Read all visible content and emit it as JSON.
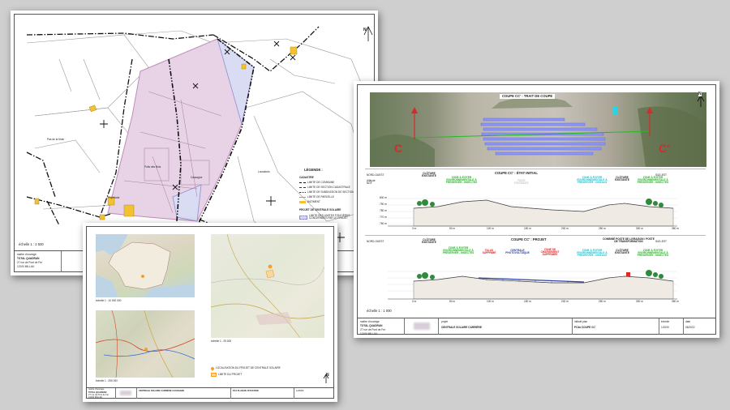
{
  "colors": {
    "background": "#cfcfcf",
    "parcel_fill": "#e8d3e6",
    "parcel_stroke": "#c28bbb",
    "project_fill": "#d9dcf3",
    "solar_yellow": "#f2c232",
    "vegetation_green": "#2f8a3b",
    "arrow_red": "#d8292b",
    "label_green": "#1fb31f",
    "label_cyan": "#17c1cf",
    "label_red": "#e01f1f",
    "label_blue": "#2a3fa8",
    "panel_blue": "#8f98f0"
  },
  "cadastral_sheet": {
    "north_letter": "N",
    "legend": {
      "title": "LÉGENDE :",
      "cadastre_heading": "CADASTRE",
      "items": [
        "LIMITE DE COMMUNE",
        "LIMITE DE SECTION CADASTRALE",
        "LIMITE DE SUBDIVISION DE SECTION",
        "LIMITE DE PARCELLE",
        "BATIMENT"
      ],
      "project_heading": "PROJET DE CENTRALE SOLAIRE",
      "project_items": [
        "LIMITE DES LIMITES FONCIÈRES CONCERNÉES PAR LE PROJET"
      ]
    },
    "scale": "échelle 1 : 2 500",
    "place_labels": [
      "Pas de la Mule",
      "Puits des Bois",
      "Lousabois",
      "Cassagne",
      "Peyrelade"
    ],
    "title_block": {
      "maitre": "maître d'ouvrage",
      "company": "TOTAL QUADRAN",
      "address1": "27 rue de Pont de Fer",
      "address2": "12100 MILLAU"
    }
  },
  "section_sheet": {
    "north_letter": "N",
    "photo_title": "COUPE CC' : TRAIT DE COUPE",
    "marker_c": "C",
    "marker_c_prime": "C'",
    "profile1": {
      "title": "COUPE CC' : ÉTAT INITIAL",
      "left_dir": "NORD-OUEST",
      "right_dir": "SUD-EST",
      "labels": [
        {
          "text": "CLÔTURE EXISTANTE",
          "kind": "black"
        },
        {
          "text": "ZONE À ÉVITER ENVIRONNEMENTALE À PRÉSERVER - INSECTES",
          "kind": "green"
        },
        {
          "text": "PISTE EXISTANTE",
          "kind": "grey"
        },
        {
          "text": "ZONE À ÉVITER ENVIRONNEMENTALE À PRÉSERVER - OISEAUX",
          "kind": "cyan"
        },
        {
          "text": "CLÔTURE EXISTANTE",
          "kind": "black"
        },
        {
          "text": "ZONE À ÉVITER ENVIRONNEMENTALE À PRÉSERVER - INSECTES",
          "kind": "green"
        }
      ],
      "x_ticks": [
        "0 m",
        "50 m",
        "100 m",
        "150 m",
        "200 m",
        "250 m",
        "300 m",
        "350 m"
      ],
      "y_ticks": [
        "800 m",
        "790 m",
        "780 m",
        "770 m",
        "760 m"
      ],
      "y_head": "Altitude NGF"
    },
    "profile2": {
      "title": "COUPE CC' : PROJET",
      "left_dir": "NORD-OUEST",
      "right_dir": "SUD-EST",
      "labels": [
        {
          "text": "CLÔTURE EXISTANTE",
          "kind": "black"
        },
        {
          "text": "ZONE À ÉVITER ENVIRONNEMENTALE À PRÉSERVER - INSECTES",
          "kind": "green"
        },
        {
          "text": "TALUS SUPPRIMÉ",
          "kind": "red"
        },
        {
          "text": "CENTRALE PHOTOVOLTAÏQUE",
          "kind": "blue"
        },
        {
          "text": "ZONE DE CHARGEMENT SUPPRIMÉE",
          "kind": "red"
        },
        {
          "text": "ZONE À ÉVITER ENVIRONNEMENTALE À PRÉSERVER - OISEAUX",
          "kind": "cyan"
        },
        {
          "text": "COMBINÉ POSTE DE LIVRAISON / POSTE DE TRANSFORMATION",
          "kind": "black"
        },
        {
          "text": "CLÔTURE EXISTANTE",
          "kind": "black"
        },
        {
          "text": "ZONE À ÉVITER ENVIRONNEMENTALE À PRÉSERVER - INSECTES",
          "kind": "green"
        }
      ],
      "x_ticks": [
        "0 m",
        "50 m",
        "100 m",
        "150 m",
        "200 m",
        "250 m",
        "300 m",
        "350 m"
      ]
    },
    "scale": "échelle 1 : 1 000",
    "title_block": {
      "maitre": "maître d'ouvrage",
      "company": "TOTAL QUADRAN",
      "address1": "27 rue de Pont de Fer",
      "address2": "12100 MILLAU",
      "projet_head": "projet",
      "projet": "CENTRALE SOLAIRE CARRIÈRE",
      "contenu_head": "intitulé plan",
      "contenu": "PC3a COUPE CC'",
      "echelle_head": "échelle",
      "echelle": "1/1000",
      "date_head": "date",
      "date": "06/2022"
    }
  },
  "location_sheet": {
    "scale_france": "échelle 1 : 10 000 000",
    "scale_region": "échelle 1 : 250 000",
    "scale_local": "échelle 1 : 25 000",
    "legend_items": [
      "LOCALISATION DU PROJET DE CENTRALE SOLAIRE",
      "LIMITE DU PROJET"
    ],
    "north_letter": "N",
    "title_block": {
      "maitre": "maître d'ouvrage",
      "company": "TOTAL QUADRAN",
      "address1": "27 rue de Pont de Fer",
      "address2": "12100 MILLAU",
      "projet": "CENTRALE SOLAIRE CARRIÈRE CASSAGNE",
      "contenu": "PC1 PLAN DE SITUATION",
      "echelle": "1/25000"
    }
  }
}
